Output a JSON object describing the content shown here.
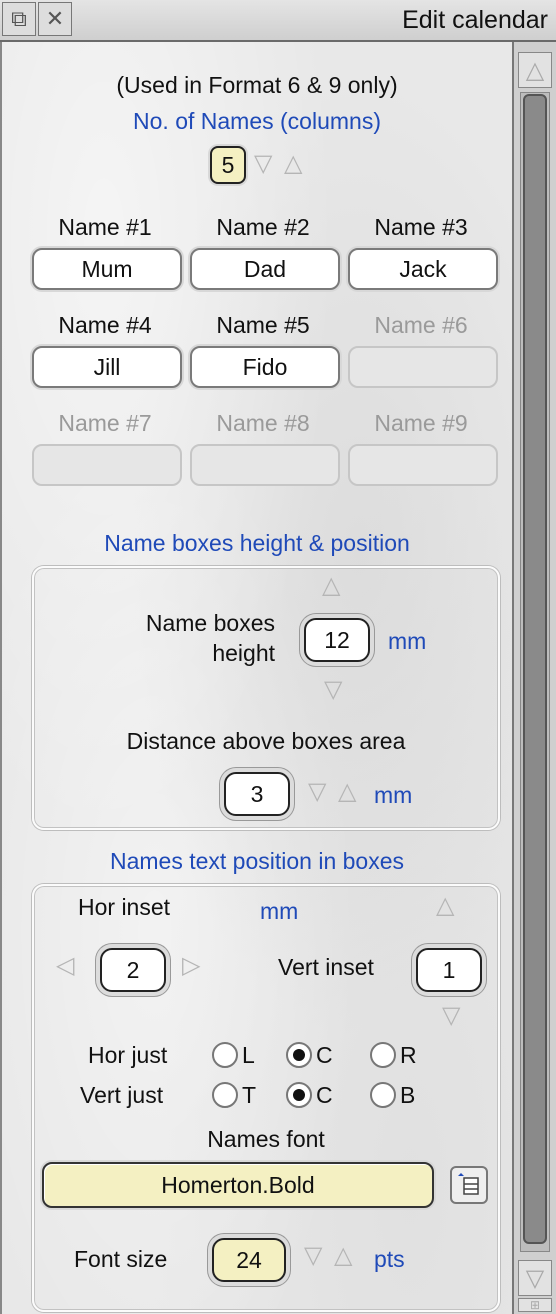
{
  "window": {
    "title": "Edit calendar"
  },
  "intro": {
    "note": "(Used in Format 6 & 9 only)",
    "no_of_names_label": "No. of Names (columns)",
    "no_of_names_value": "5"
  },
  "names": {
    "labels": [
      "Name #1",
      "Name #2",
      "Name #3",
      "Name #4",
      "Name #5",
      "Name #6",
      "Name #7",
      "Name #8",
      "Name #9"
    ],
    "values": [
      "Mum",
      "Dad",
      "Jack",
      "Jill",
      "Fido",
      "",
      "",
      "",
      ""
    ]
  },
  "boxes": {
    "section_title": "Name boxes height & position",
    "height_label_line1": "Name boxes",
    "height_label_line2": "height",
    "height_value": "12",
    "height_unit": "mm",
    "distance_label": "Distance above boxes area",
    "distance_value": "3",
    "distance_unit": "mm"
  },
  "text_pos": {
    "section_title": "Names text position in boxes",
    "hor_inset_label": "Hor inset",
    "hor_inset_unit": "mm",
    "hor_inset_value": "2",
    "vert_inset_label": "Vert inset",
    "vert_inset_value": "1",
    "hor_just_label": "Hor just",
    "hor_just_options": [
      "L",
      "C",
      "R"
    ],
    "hor_just_selected": "C",
    "vert_just_label": "Vert just",
    "vert_just_options": [
      "T",
      "C",
      "B"
    ],
    "vert_just_selected": "C",
    "font_label": "Names font",
    "font_value": "Homerton.Bold",
    "font_size_label": "Font size",
    "font_size_value": "24",
    "font_size_unit": "pts"
  }
}
